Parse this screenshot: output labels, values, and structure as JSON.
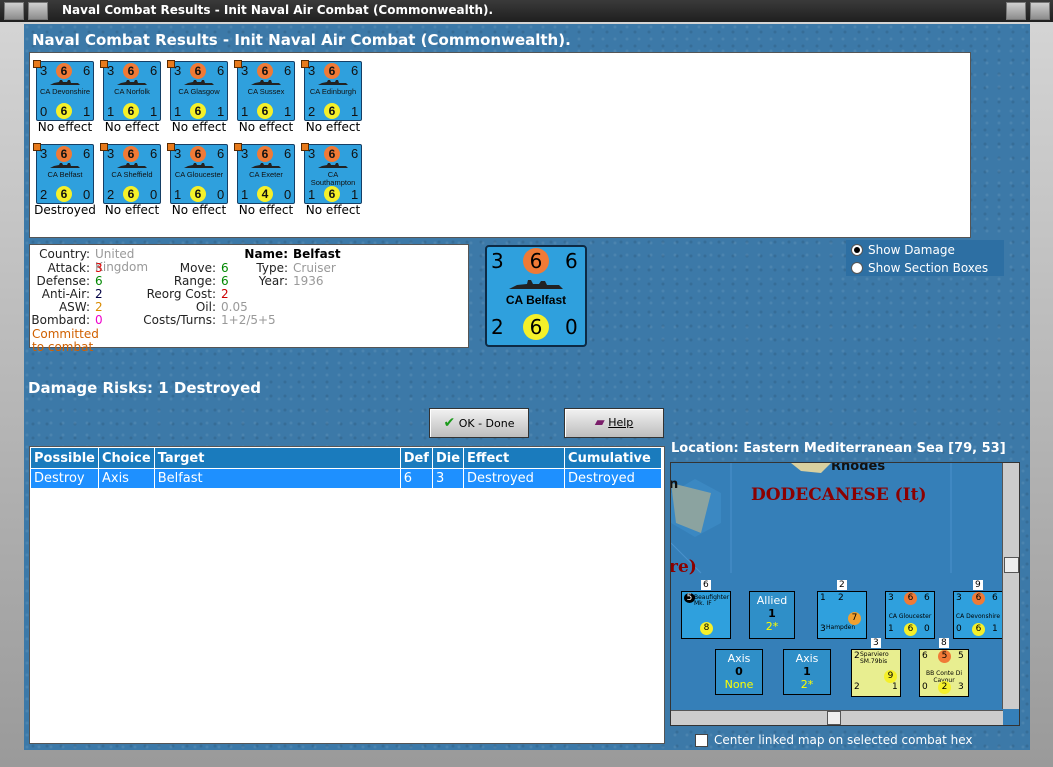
{
  "window": {
    "title": "Naval Combat Results - Init Naval Air Combat (Commonwealth)."
  },
  "header": {
    "title": "Naval Combat Results - Init Naval Air Combat (Commonwealth)."
  },
  "units": [
    {
      "name": "CA Devonshire",
      "top_left": "3",
      "top_mid": "6",
      "top_right": "6",
      "bot_left": "0",
      "bot_mid": "6",
      "bot_right": "1",
      "result": "No effect"
    },
    {
      "name": "CA Norfolk",
      "top_left": "3",
      "top_mid": "6",
      "top_right": "6",
      "bot_left": "1",
      "bot_mid": "6",
      "bot_right": "1",
      "result": "No effect"
    },
    {
      "name": "CA Glasgow",
      "top_left": "3",
      "top_mid": "6",
      "top_right": "6",
      "bot_left": "1",
      "bot_mid": "6",
      "bot_right": "1",
      "result": "No effect"
    },
    {
      "name": "CA Sussex",
      "top_left": "3",
      "top_mid": "6",
      "top_right": "6",
      "bot_left": "1",
      "bot_mid": "6",
      "bot_right": "1",
      "result": "No effect"
    },
    {
      "name": "CA Edinburgh",
      "top_left": "3",
      "top_mid": "6",
      "top_right": "6",
      "bot_left": "2",
      "bot_mid": "6",
      "bot_right": "1",
      "result": "No effect"
    },
    {
      "name": "CA Belfast",
      "top_left": "3",
      "top_mid": "6",
      "top_right": "6",
      "bot_left": "2",
      "bot_mid": "6",
      "bot_right": "0",
      "result": "Destroyed"
    },
    {
      "name": "CA Sheffield",
      "top_left": "3",
      "top_mid": "6",
      "top_right": "6",
      "bot_left": "2",
      "bot_mid": "6",
      "bot_right": "0",
      "result": "No effect"
    },
    {
      "name": "CA Gloucester",
      "top_left": "3",
      "top_mid": "6",
      "top_right": "6",
      "bot_left": "1",
      "bot_mid": "6",
      "bot_right": "0",
      "result": "No effect"
    },
    {
      "name": "CA Exeter",
      "top_left": "3",
      "top_mid": "6",
      "top_right": "6",
      "bot_left": "1",
      "bot_mid": "4",
      "bot_right": "0",
      "result": "No effect"
    },
    {
      "name": "CA Southampton",
      "top_left": "3",
      "top_mid": "6",
      "top_right": "6",
      "bot_left": "1",
      "bot_mid": "6",
      "bot_right": "1",
      "result": "No effect"
    }
  ],
  "details": {
    "country_label": "Country:",
    "country": "United Kingdom",
    "attack_label": "Attack:",
    "attack": "3",
    "defense_label": "Defense:",
    "defense": "6",
    "antiair_label": "Anti-Air:",
    "antiair": "2",
    "asw_label": "ASW:",
    "asw": "2",
    "bombard_label": "Bombard:",
    "bombard": "0",
    "move_label": "Move:",
    "move": "6",
    "range_label": "Range:",
    "range": "6",
    "reorg_label": "Reorg Cost:",
    "reorg": "2",
    "oil_label": "Oil:",
    "oil": "0.05",
    "costs_label": "Costs/Turns:",
    "costs": "1+2/5+5",
    "name_label": "Name:",
    "name": "Belfast",
    "type_label": "Type:",
    "type": "Cruiser",
    "year_label": "Year:",
    "year": "1936",
    "status": "Committed to combat"
  },
  "big_counter": {
    "name": "CA Belfast",
    "top_left": "3",
    "top_mid": "6",
    "top_right": "6",
    "bot_left": "2",
    "bot_mid": "6",
    "bot_right": "0"
  },
  "options": {
    "show_damage": "Show Damage",
    "show_section_boxes": "Show Section Boxes"
  },
  "damage_risks": "Damage Risks:  1 Destroyed",
  "buttons": {
    "ok": "OK - Done",
    "help": "Help"
  },
  "table": {
    "headers": [
      "Possible",
      "Choice",
      "Target",
      "Def",
      "Die",
      "Effect",
      "Cumulative"
    ],
    "rows": [
      [
        "Destroy",
        "Axis",
        "Belfast",
        "6",
        "3",
        "Destroyed",
        "Destroyed"
      ]
    ]
  },
  "location": "Location:  Eastern Mediterranean Sea [79, 53]",
  "map": {
    "region": "DODECANESE (It)",
    "top_label": "Rhodes",
    "left_label_1": "n",
    "left_label_2": "re)",
    "allied_box": {
      "title": "Allied",
      "count": "1",
      "sub": "2*"
    },
    "axis_box_1": {
      "title": "Axis",
      "count": "0",
      "sub": "None"
    },
    "axis_box_2": {
      "title": "Axis",
      "count": "1",
      "sub": "2*"
    },
    "stack_numbers": [
      "6",
      "2",
      "9",
      "3",
      "8"
    ],
    "units": [
      {
        "name": "Beaufighter Mk. IF",
        "tl": "5",
        "bm": "8"
      },
      {
        "name": "Hampden",
        "tl": "1",
        "tr": "2",
        "bl": "3",
        "bm": "7"
      },
      {
        "name": "CA Gloucester",
        "tl": "3",
        "tm": "6",
        "tr": "6",
        "bl": "1",
        "bm": "6",
        "br": "0"
      },
      {
        "name": "CA Devonshire",
        "tl": "3",
        "tm": "6",
        "tr": "6",
        "bl": "0",
        "bm": "6",
        "br": "1"
      },
      {
        "name": "Sparviero SM.79bis",
        "tl": "2",
        "bl": "2",
        "bm": "9",
        "br": "1"
      },
      {
        "name": "BB Conte Di Cavour",
        "tl": "6",
        "tm": "5",
        "tr": "5",
        "bl": "0",
        "bm": "2",
        "br": "3"
      }
    ]
  },
  "center_map_label": "Center linked map on selected combat hex",
  "colors": {
    "panel": "#3c79a8",
    "counter": "#2fa0dd",
    "selected_row": "#1e90ff",
    "region_label": "#8b0000"
  }
}
